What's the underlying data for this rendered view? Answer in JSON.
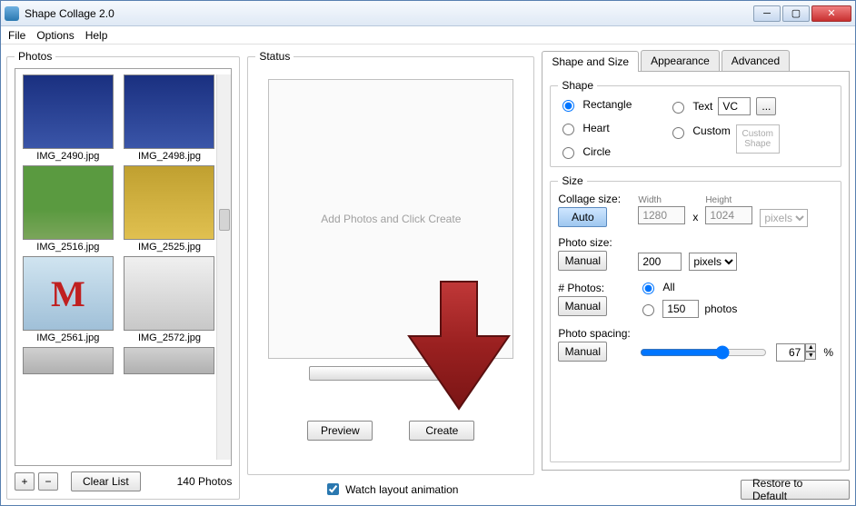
{
  "window": {
    "title": "Shape Collage 2.0"
  },
  "menu": {
    "file": "File",
    "options": "Options",
    "help": "Help"
  },
  "photos": {
    "legend": "Photos",
    "items": [
      {
        "file": "IMG_2490.jpg",
        "cls": "sky"
      },
      {
        "file": "IMG_2498.jpg",
        "cls": "sky"
      },
      {
        "file": "IMG_2516.jpg",
        "cls": "green"
      },
      {
        "file": "IMG_2525.jpg",
        "cls": "gold"
      },
      {
        "file": "IMG_2561.jpg",
        "cls": "metro",
        "glyph": "M"
      },
      {
        "file": "IMG_2572.jpg",
        "cls": "basil"
      }
    ],
    "add": "+",
    "remove": "−",
    "clear": "Clear List",
    "count": "140 Photos"
  },
  "status": {
    "legend": "Status",
    "placeholder": "Add Photos and Click Create",
    "preview": "Preview",
    "create": "Create",
    "watch": "Watch layout animation",
    "watch_checked": true
  },
  "tabs": {
    "shape": "Shape and Size",
    "appearance": "Appearance",
    "advanced": "Advanced"
  },
  "shape": {
    "legend": "Shape",
    "rectangle": "Rectangle",
    "heart": "Heart",
    "circle": "Circle",
    "text": "Text",
    "text_value": "VC",
    "dots": "...",
    "custom": "Custom",
    "custom_shape": "Custom Shape",
    "selected": "rectangle"
  },
  "size": {
    "legend": "Size",
    "collage_label": "Collage size:",
    "auto": "Auto",
    "width_label": "Width",
    "width": "1280",
    "x": "x",
    "height_label": "Height",
    "height": "1024",
    "unit": "pixels",
    "photo_label": "Photo size:",
    "manual": "Manual",
    "photo_value": "200",
    "count_label": "# Photos:",
    "all": "All",
    "count_value": "150",
    "photos_word": "photos",
    "spacing_label": "Photo spacing:",
    "spacing_value": "67",
    "percent": "%"
  },
  "restore": "Restore to Default"
}
